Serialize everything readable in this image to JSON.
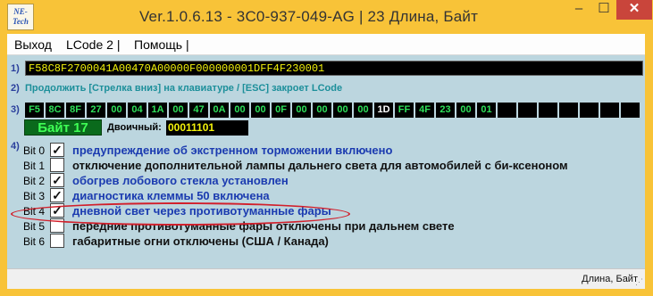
{
  "window": {
    "logo_top": "NE-",
    "logo_bottom": "Tech",
    "title": "Ver.1.0.6.13 -    3C0-937-049-AG | 23 Длина, Байт",
    "minimize": "–",
    "maximize": "☐",
    "close": "✕"
  },
  "menu": {
    "exit": "Выход",
    "lcode": "LCode 2 |",
    "help": "Помощь |"
  },
  "rows": {
    "r1": "1)",
    "r2": "2)",
    "r3": "3)",
    "r4": "4)"
  },
  "lcode_value": "F58C8F2700041A00470A00000F000000001DFF4F230001",
  "hint": "Продолжить [Стрелка вниз] на клавиатуре / [ESC] закроет LCode",
  "bytes": [
    "F5",
    "8C",
    "8F",
    "27",
    "00",
    "04",
    "1A",
    "00",
    "47",
    "0A",
    "00",
    "00",
    "0F",
    "00",
    "00",
    "00",
    "00",
    "1D",
    "FF",
    "4F",
    "23",
    "00",
    "01",
    "",
    "",
    "",
    "",
    "",
    "",
    ""
  ],
  "selected_byte_index": 17,
  "byte_label": "Байт 17",
  "binary_label": "Двоичный:",
  "binary_value": "00011101",
  "bits": [
    {
      "name": "Bit 0",
      "checked": true,
      "mark": "✓",
      "desc": "предупреждение об экстренном торможении включено"
    },
    {
      "name": "Bit 1",
      "checked": false,
      "mark": "",
      "desc": "отключение дополнительной лампы дальнего света для автомобилей с би-ксеноном"
    },
    {
      "name": "Bit 2",
      "checked": true,
      "mark": "✓",
      "desc": "обогрев лобового стекла установлен"
    },
    {
      "name": "Bit 3",
      "checked": true,
      "mark": "✓",
      "desc": "диагностика клеммы 50 включена"
    },
    {
      "name": "Bit 4",
      "checked": true,
      "mark": "✓",
      "desc": "дневной свет через противотуманные фары"
    },
    {
      "name": "Bit 5",
      "checked": false,
      "mark": "",
      "desc": "передние противотуманные фары отключены при дальнем свете"
    },
    {
      "name": "Bit 6",
      "checked": false,
      "mark": "",
      "desc": "габаритные огни отключены (США / Канада)"
    }
  ],
  "status": {
    "text": "Длина, Байт",
    "grip": "⋰"
  },
  "colors": {
    "frame": "#f8c338",
    "client": "#bcd6df",
    "byte_text": "#2fe05a",
    "code_text": "#f3f20b",
    "bit_on": "#1b3bb0",
    "highlight": "#d21f2b"
  }
}
